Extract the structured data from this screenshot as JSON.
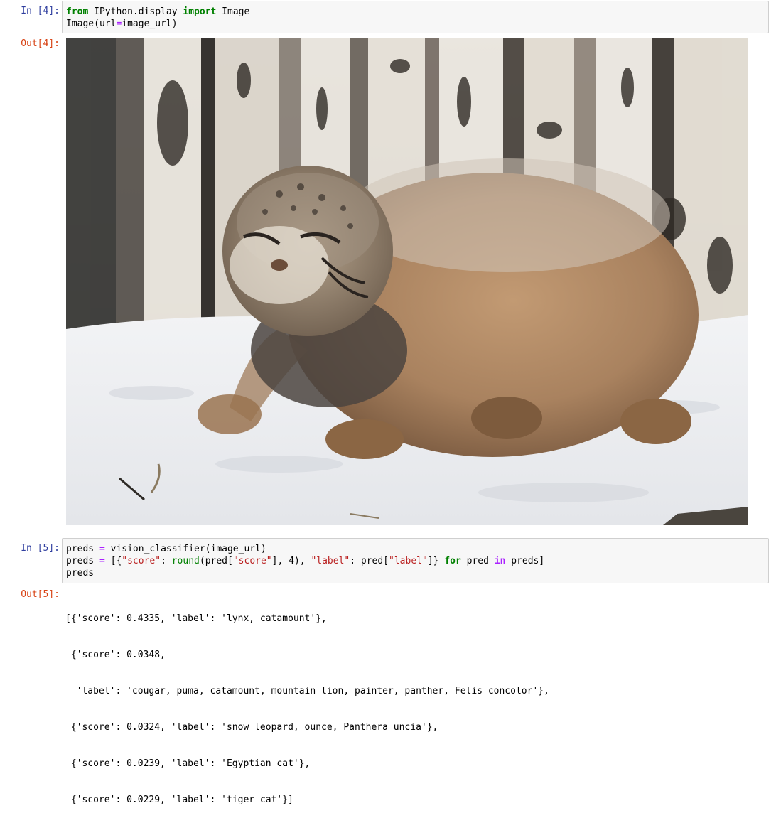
{
  "cells": [
    {
      "in_prompt": "In [4]:",
      "code_lines": [
        [
          {
            "t": "from",
            "c": "kw"
          },
          {
            "t": " IPython.display ",
            "c": ""
          },
          {
            "t": "import",
            "c": "kw"
          },
          {
            "t": " Image",
            "c": ""
          }
        ],
        [
          {
            "t": "Image(url",
            "c": ""
          },
          {
            "t": "=",
            "c": "op"
          },
          {
            "t": "image_url)",
            "c": ""
          }
        ]
      ],
      "out_prompt": "Out[4]:",
      "output_kind": "image",
      "output_image_subject": "Pallas cat walking in snow in front of birch logs"
    },
    {
      "in_prompt": "In [5]:",
      "code_lines": [
        [
          {
            "t": "preds ",
            "c": ""
          },
          {
            "t": "=",
            "c": "op"
          },
          {
            "t": " vision_classifier(image_url)",
            "c": ""
          }
        ],
        [
          {
            "t": "preds ",
            "c": ""
          },
          {
            "t": "=",
            "c": "op"
          },
          {
            "t": " [{",
            "c": ""
          },
          {
            "t": "\"score\"",
            "c": "str"
          },
          {
            "t": ": ",
            "c": ""
          },
          {
            "t": "round",
            "c": "builtin"
          },
          {
            "t": "(pred[",
            "c": ""
          },
          {
            "t": "\"score\"",
            "c": "str"
          },
          {
            "t": "], 4), ",
            "c": ""
          },
          {
            "t": "\"label\"",
            "c": "str"
          },
          {
            "t": ": pred[",
            "c": ""
          },
          {
            "t": "\"label\"",
            "c": "str"
          },
          {
            "t": "]} ",
            "c": ""
          },
          {
            "t": "for",
            "c": "kw"
          },
          {
            "t": " pred ",
            "c": ""
          },
          {
            "t": "in",
            "c": "inop"
          },
          {
            "t": " preds]",
            "c": ""
          }
        ],
        [
          {
            "t": "preds",
            "c": ""
          }
        ]
      ],
      "out_prompt": "Out[5]:",
      "output_kind": "text",
      "output_lines": [
        "[{'score': 0.4335, 'label': 'lynx, catamount'},",
        " {'score': 0.0348,",
        "  'label': 'cougar, puma, catamount, mountain lion, painter, panther, Felis concolor'},",
        " {'score': 0.0324, 'label': 'snow leopard, ounce, Panthera uncia'},",
        " {'score': 0.0239, 'label': 'Egyptian cat'},",
        " {'score': 0.0229, 'label': 'tiger cat'}]"
      ]
    }
  ]
}
